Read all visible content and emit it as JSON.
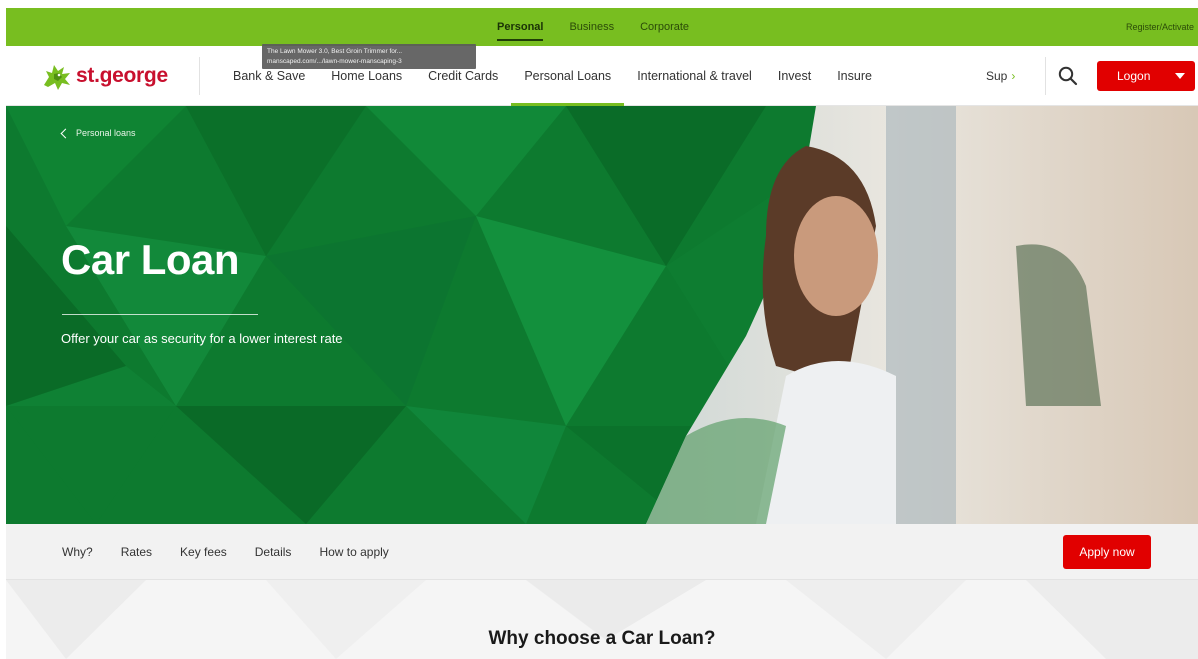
{
  "segments": [
    {
      "label": "Personal",
      "active": true
    },
    {
      "label": "Business",
      "active": false
    },
    {
      "label": "Corporate",
      "active": false
    }
  ],
  "register_label": "Register/Activate",
  "brand": {
    "name": "st.george",
    "color": "#c8102e",
    "accent": "#78be20"
  },
  "nav": {
    "items": [
      {
        "label": "Bank & Save"
      },
      {
        "label": "Home Loans"
      },
      {
        "label": "Credit Cards"
      },
      {
        "label": "Personal Loans"
      },
      {
        "label": "International & travel"
      },
      {
        "label": "Invest"
      },
      {
        "label": "Insure"
      }
    ],
    "more_label": "Sup",
    "more_icon": "chevron-right-icon",
    "search_icon": "search-icon",
    "logon_label": "Logon",
    "logon_color": "#e10000"
  },
  "tooltip": {
    "line1": "The Lawn Mower 3.0, Best Groin Trimmer for...",
    "line2": "manscaped.com/.../lawn-mower-manscaping-3"
  },
  "hero": {
    "breadcrumb": "Personal loans",
    "title": "Car Loan",
    "subtitle": "Offer your car as security for a lower interest rate",
    "bg_color": "#0d7a2f"
  },
  "subnav": {
    "items": [
      "Why?",
      "Rates",
      "Key fees",
      "Details",
      "How to apply"
    ],
    "apply_label": "Apply now"
  },
  "why": {
    "title": "Why choose a Car Loan?"
  }
}
